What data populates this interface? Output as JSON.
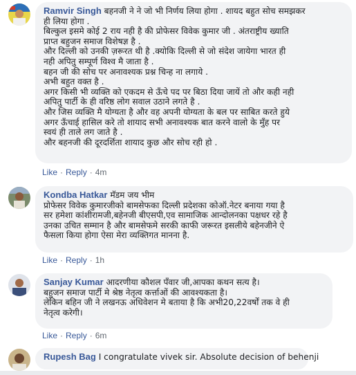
{
  "comments": [
    {
      "author": "Ramvir Singh",
      "lines": [
        "बहनजी ने ने जो भी निर्णय लिया होगा . शायद बहुत सोच समझकर",
        "ही लिया होगा .",
        "बिल्कुल इसमे कोई 2 राय नही है की प्रोफेसर विवेक कुमार जी . अंतराष्ट्रीय ख्याति",
        "प्राप्त बहुजन समाज विशेषज्ञ है .",
        "और दिल्ली को उनकी ज़रूरत थी है .क्योकि दिल्ली से जो संदेश जायेगा भारत ही",
        "नही अपितु सम्पूर्ण विश्व मै जाता है .",
        "बहन जी की सोच पर अनावश्यक प्रश्न चिन्ह ना लगाये .",
        "अभी बहुत वक्त है .",
        "अगर किसी भी व्यक्ति को एकदम से ऊँचे पद पर बिठा दिया जायें तो और कही नही",
        "अपितु पार्टी के ही वरिष्ठ लोग सवाल उठाने लगते है .",
        "और जिस व्यक्ति मै योग्यता है और वह अपनी योग्यता के बल पर साबित करते हुये",
        "अगर ऊँचाई हासिल करे तो शायाद सभी अनावश्यक बात करने वालो के मुँह पर",
        "स्वयं ही ताले लग जाते है .",
        "और बहनजी की दूरदर्शिता शायाद कुछ और सोच रही हो ."
      ],
      "like": "Like",
      "reply": "Reply",
      "time": "4m"
    },
    {
      "author": "Kondba Hatkar",
      "lines": [
        "मॅडम जय भीम",
        "प्रोफेसर विवेक कुमारजीको बामसेफका दिल्ली प्रदेशका कोऑ.नेटर बनाया गया है",
        "सर हमेशा कांशीरामजी,बहेनजी बीएसपी,एव सामाजिक आन्दोलनका पक्षधर रहे है",
        "उनका उचित सम्मान है और बामसेफमे सरकी काफी जरूरत इसलीये बहेनजीने ऐ",
        "फैसला किया होगा ऐसा मेरा व्यक्तिगत मानना है."
      ],
      "like": "Like",
      "reply": "Reply",
      "time": "1h"
    },
    {
      "author": "Sanjay Kumar",
      "lines": [
        "आदरणीया कौशल पँवार जी,आपका कथन सत्य है।",
        "बहुजन समाज पार्टी मे श्रेष्ठ नेतृत्व कर्त्ताओं की आवश्यकता है।",
        "लेकिन बहिन जी ने लखनऊ अधिवेशन मे बताया है कि अभी20,22वर्षों तक वे ही",
        "नेतृत्व करेगी।"
      ],
      "like": "Like",
      "reply": "Reply",
      "time": "6m"
    },
    {
      "author": "Rupesh Bag",
      "lines": [
        "I congratulate vivek sir. Absolute decision of behenji"
      ]
    }
  ]
}
